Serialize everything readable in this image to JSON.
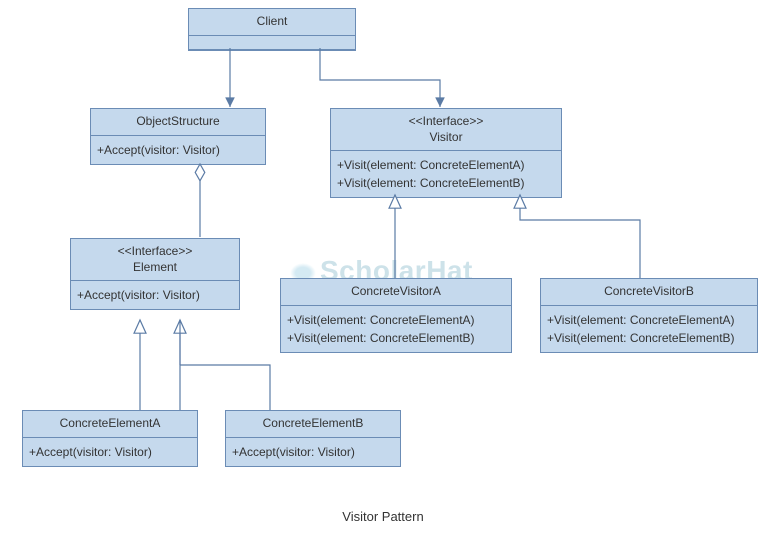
{
  "caption": "Visitor Pattern",
  "watermark": "ScholarHat",
  "boxes": {
    "client": {
      "name": "Client"
    },
    "objectStructure": {
      "name": "ObjectStructure",
      "ops": [
        "+Accept(visitor: Visitor)"
      ]
    },
    "visitor": {
      "stereotype": "<<Interface>>",
      "name": "Visitor",
      "ops": [
        "+Visit(element: ConcreteElementA)",
        "+Visit(element: ConcreteElementB)"
      ]
    },
    "element": {
      "stereotype": "<<Interface>>",
      "name": "Element",
      "ops": [
        "+Accept(visitor: Visitor)"
      ]
    },
    "concreteVisitorA": {
      "name": "ConcreteVisitorA",
      "ops": [
        "+Visit(element: ConcreteElementA)",
        "+Visit(element: ConcreteElementB)"
      ]
    },
    "concreteVisitorB": {
      "name": "ConcreteVisitorB",
      "ops": [
        "+Visit(element: ConcreteElementA)",
        "+Visit(element: ConcreteElementB)"
      ]
    },
    "concreteElementA": {
      "name": "ConcreteElementA",
      "ops": [
        "+Accept(visitor: Visitor)"
      ]
    },
    "concreteElementB": {
      "name": "ConcreteElementB",
      "ops": [
        "+Accept(visitor: Visitor)"
      ]
    }
  },
  "relations": [
    {
      "from": "Client",
      "to": "ObjectStructure",
      "type": "association-arrow"
    },
    {
      "from": "Client",
      "to": "Visitor",
      "type": "association-arrow"
    },
    {
      "from": "ObjectStructure",
      "to": "Element",
      "type": "aggregation"
    },
    {
      "from": "ConcreteVisitorA",
      "to": "Visitor",
      "type": "realization"
    },
    {
      "from": "ConcreteVisitorB",
      "to": "Visitor",
      "type": "realization"
    },
    {
      "from": "ConcreteElementA",
      "to": "Element",
      "type": "realization"
    },
    {
      "from": "ConcreteElementB",
      "to": "Element",
      "type": "realization"
    }
  ]
}
